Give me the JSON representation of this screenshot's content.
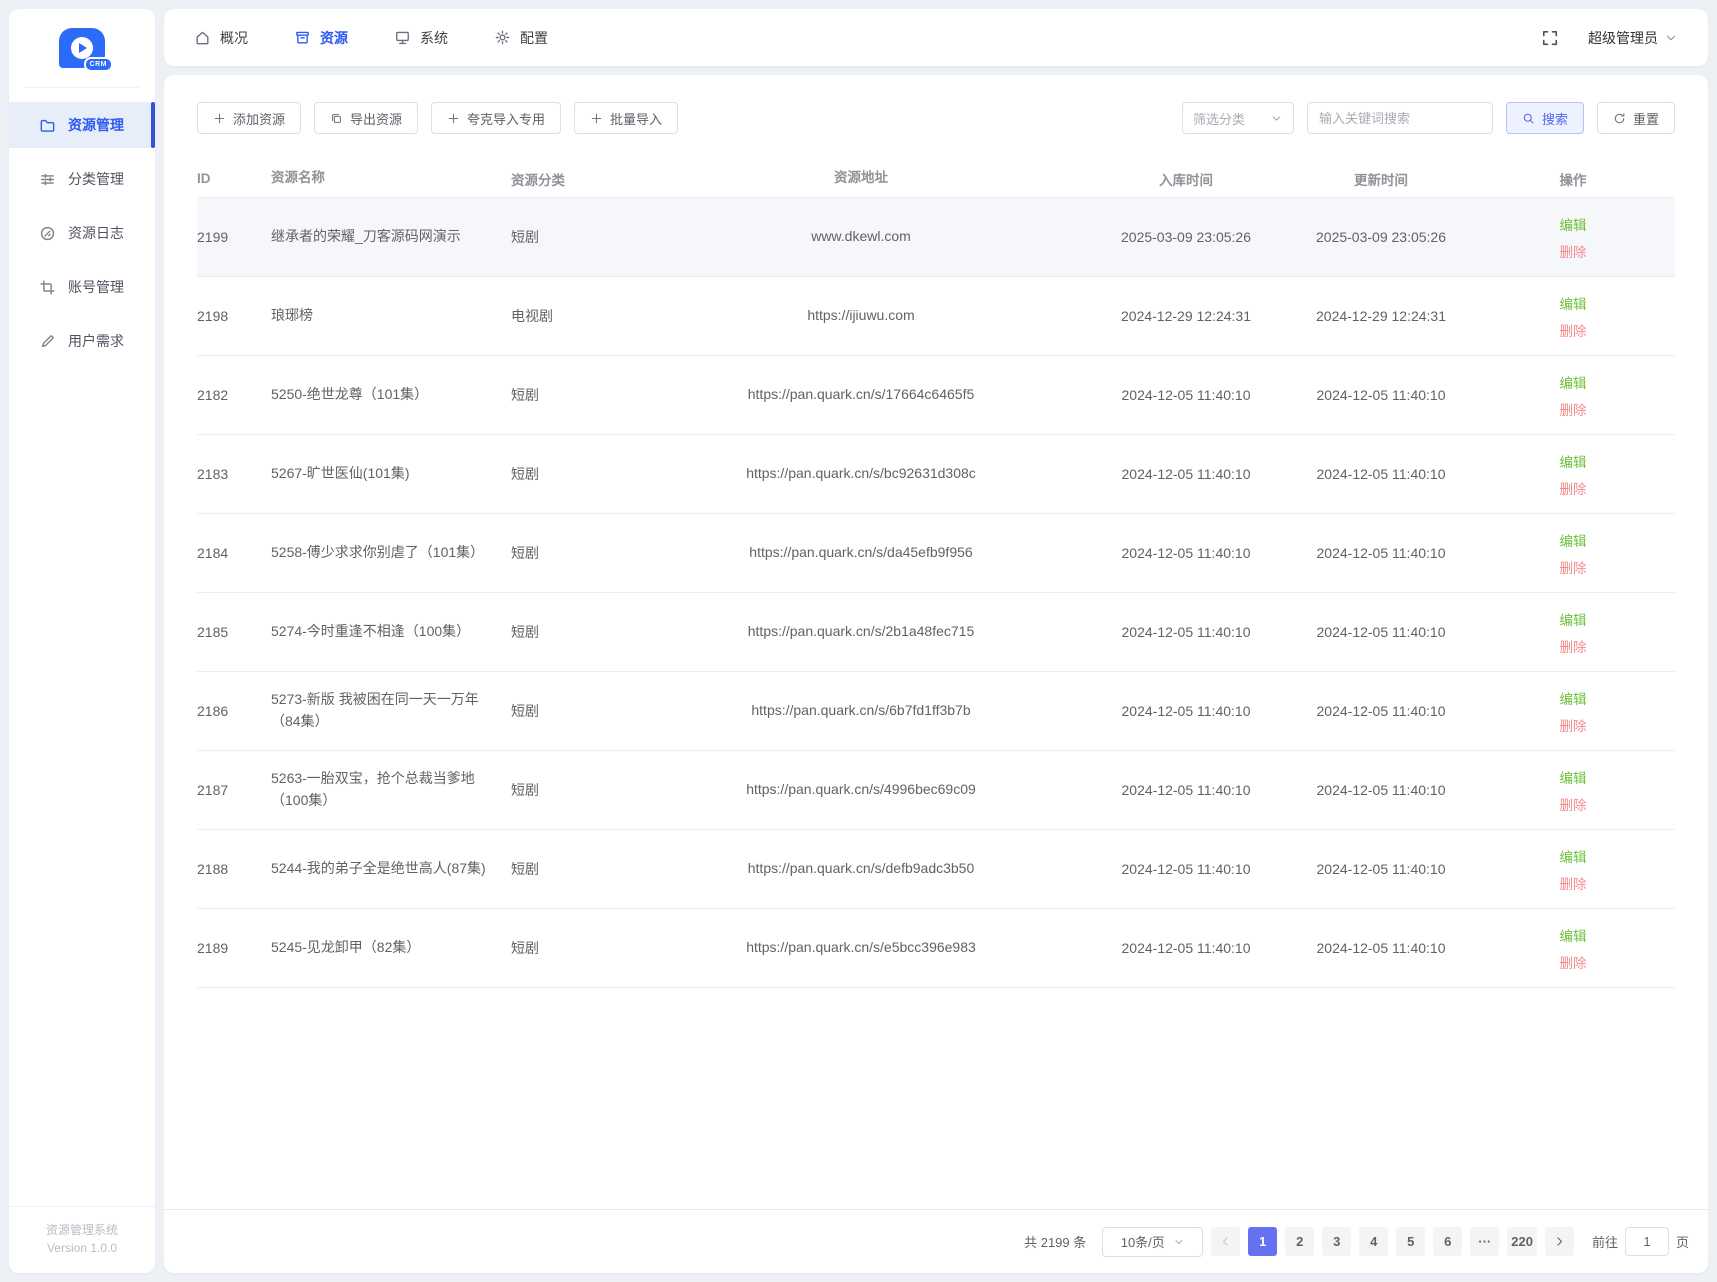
{
  "app": {
    "logo_text": "CRM",
    "footer_title": "资源管理系统",
    "footer_version": "Version 1.0.0"
  },
  "colors": {
    "primary": "#2e5bf0",
    "sidebar_active_bar": "#2f54d8",
    "edit_green": "#6cc23a",
    "delete_red": "#f78989",
    "pagination_active": "#6471f0"
  },
  "topnav": {
    "items": [
      {
        "id": "overview",
        "label": "概况",
        "icon": "home-icon",
        "active": false
      },
      {
        "id": "resources",
        "label": "资源",
        "icon": "box-icon",
        "active": true
      },
      {
        "id": "system",
        "label": "系统",
        "icon": "monitor-icon",
        "active": false
      },
      {
        "id": "config",
        "label": "配置",
        "icon": "gear-icon",
        "active": false
      }
    ],
    "fullscreen_icon": "fullscreen-icon",
    "user_label": "超级管理员",
    "user_chevron_icon": "chevron-down-icon"
  },
  "sidebar": {
    "items": [
      {
        "id": "resource-management",
        "label": "资源管理",
        "icon": "folder-icon",
        "active": true
      },
      {
        "id": "category-management",
        "label": "分类管理",
        "icon": "sliders-icon",
        "active": false
      },
      {
        "id": "resource-logs",
        "label": "资源日志",
        "icon": "log-icon",
        "active": false
      },
      {
        "id": "account-management",
        "label": "账号管理",
        "icon": "crop-icon",
        "active": false
      },
      {
        "id": "user-needs",
        "label": "用户需求",
        "icon": "pen-icon",
        "active": false
      }
    ]
  },
  "toolbar": {
    "add_label": "添加资源",
    "export_label": "导出资源",
    "quark_label": "夸克导入专用",
    "batch_label": "批量导入",
    "filter_placeholder": "筛选分类",
    "search_placeholder": "输入关键词搜索",
    "search_label": "搜索",
    "reset_label": "重置"
  },
  "table": {
    "columns": [
      {
        "key": "id",
        "label": "ID"
      },
      {
        "key": "name",
        "label": "资源名称"
      },
      {
        "key": "category",
        "label": "资源分类"
      },
      {
        "key": "address",
        "label": "资源地址"
      },
      {
        "key": "created_at",
        "label": "入库时间"
      },
      {
        "key": "updated_at",
        "label": "更新时间"
      },
      {
        "key": "actions",
        "label": "操作"
      }
    ],
    "actions": {
      "edit_label": "编辑",
      "delete_label": "删除"
    },
    "rows": [
      {
        "id": "2199",
        "name": "继承者的荣耀_刀客源码网演示",
        "category": "短剧",
        "address": "www.dkewl.com",
        "created_at": "2025-03-09 23:05:26",
        "updated_at": "2025-03-09 23:05:26",
        "highlighted": true
      },
      {
        "id": "2198",
        "name": "琅琊榜",
        "category": "电视剧",
        "address": "https://ijiuwu.com",
        "created_at": "2024-12-29 12:24:31",
        "updated_at": "2024-12-29 12:24:31",
        "highlighted": false
      },
      {
        "id": "2182",
        "name": "5250-绝世龙尊（101集）",
        "category": "短剧",
        "address": "https://pan.quark.cn/s/17664c6465f5",
        "created_at": "2024-12-05 11:40:10",
        "updated_at": "2024-12-05 11:40:10",
        "highlighted": false
      },
      {
        "id": "2183",
        "name": "5267-旷世医仙(101集)",
        "category": "短剧",
        "address": "https://pan.quark.cn/s/bc92631d308c",
        "created_at": "2024-12-05 11:40:10",
        "updated_at": "2024-12-05 11:40:10",
        "highlighted": false
      },
      {
        "id": "2184",
        "name": "5258-傅少求求你别虐了（101集）",
        "category": "短剧",
        "address": "https://pan.quark.cn/s/da45efb9f956",
        "created_at": "2024-12-05 11:40:10",
        "updated_at": "2024-12-05 11:40:10",
        "highlighted": false
      },
      {
        "id": "2185",
        "name": "5274-今时重逢不相逢（100集）",
        "category": "短剧",
        "address": "https://pan.quark.cn/s/2b1a48fec715",
        "created_at": "2024-12-05 11:40:10",
        "updated_at": "2024-12-05 11:40:10",
        "highlighted": false
      },
      {
        "id": "2186",
        "name": "5273-新版 我被困在同一天一万年（84集）",
        "category": "短剧",
        "address": "https://pan.quark.cn/s/6b7fd1ff3b7b",
        "created_at": "2024-12-05 11:40:10",
        "updated_at": "2024-12-05 11:40:10",
        "highlighted": false
      },
      {
        "id": "2187",
        "name": "5263-一胎双宝，抢个总裁当爹地（100集）",
        "category": "短剧",
        "address": "https://pan.quark.cn/s/4996bec69c09",
        "created_at": "2024-12-05 11:40:10",
        "updated_at": "2024-12-05 11:40:10",
        "highlighted": false
      },
      {
        "id": "2188",
        "name": "5244-我的弟子全是绝世高人(87集)",
        "category": "短剧",
        "address": "https://pan.quark.cn/s/defb9adc3b50",
        "created_at": "2024-12-05 11:40:10",
        "updated_at": "2024-12-05 11:40:10",
        "highlighted": false
      },
      {
        "id": "2189",
        "name": "5245-见龙卸甲（82集）",
        "category": "短剧",
        "address": "https://pan.quark.cn/s/e5bcc396e983",
        "created_at": "2024-12-05 11:40:10",
        "updated_at": "2024-12-05 11:40:10",
        "highlighted": false
      }
    ]
  },
  "pagination": {
    "total_label": "共 2199 条",
    "page_size_label": "10条/页",
    "pages": [
      "1",
      "2",
      "3",
      "4",
      "5",
      "6",
      "···",
      "220"
    ],
    "active_page": "1",
    "prev_icon": "chevron-left-icon",
    "next_icon": "chevron-right-icon",
    "goto_label": "前往",
    "goto_value": "1",
    "goto_suffix": "页"
  }
}
